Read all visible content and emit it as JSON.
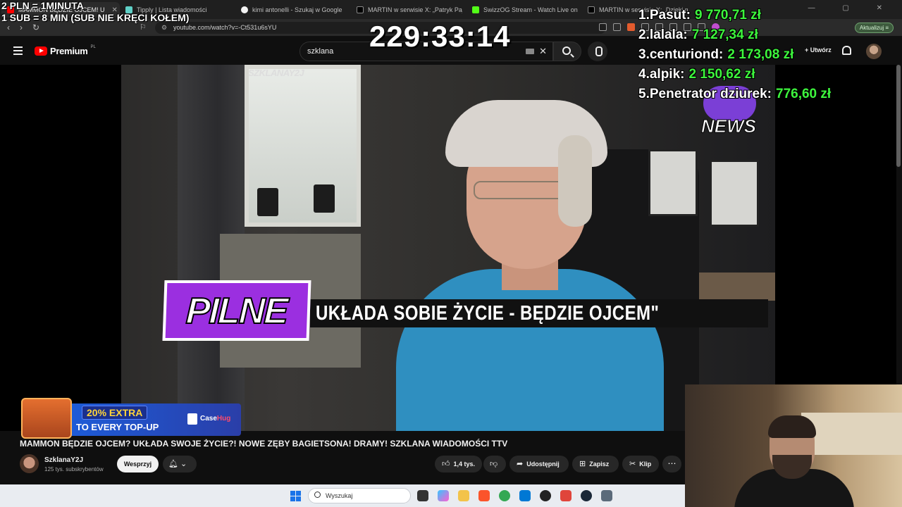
{
  "overlay": {
    "rate_line1": "2 PLN = 1MINUTA",
    "rate_line2": "1 SUB = 8 MIN (SUB NIE KRĘCI KOŁEM)",
    "timer": "229:33:14",
    "leaderboard": [
      {
        "rank": "1.",
        "name": "Pasut:",
        "amount": "9 770,71 zł"
      },
      {
        "rank": "2.",
        "name": "lalala:",
        "amount": "7 127,34 zł"
      },
      {
        "rank": "3.",
        "name": "centuriond:",
        "amount": "2 173,08 zł"
      },
      {
        "rank": "4.",
        "name": "alpik:",
        "amount": "2 150,62 zł"
      },
      {
        "rank": "5.",
        "name": "Penetrator dziurek:",
        "amount": "776,60 zł"
      }
    ],
    "leaderboard_amount_color": "#3df53d"
  },
  "browser": {
    "tabs": [
      {
        "label": "MAMMON BĘDZIE OJCEM! U",
        "active": true,
        "icon": "youtube-icon"
      },
      {
        "label": "Tipply | Lista wiadomości",
        "active": false,
        "icon": "tipply-icon"
      },
      {
        "label": "kimi antonelli - Szukaj w Google",
        "active": false,
        "icon": "google-icon"
      },
      {
        "label": "MARTIN w serwisie X: „Patryk Pajako",
        "active": false,
        "icon": "x-icon"
      },
      {
        "label": "SwizzOG Stream - Watch Live on Kick",
        "active": false,
        "icon": "kick-icon"
      },
      {
        "label": "MARTIN w serwisie X: „Dzieki mory",
        "active": false,
        "icon": "x-icon"
      }
    ],
    "url": "youtube.com/watch?v=-Ct531u6sYU",
    "update_label": "Aktualizuj"
  },
  "youtube": {
    "logo_text": "Premium",
    "logo_region": "PL",
    "search_value": "szklana",
    "create_label": "Utwórz",
    "video": {
      "channel_watermark": "SZKLANAY2J",
      "news_logo": "NEWS",
      "pilne_label": "PILNE",
      "ticker_text": "UKŁADA SOBIE ŻYCIE - BĘDZIE OJCEM\""
    },
    "title": "MAMMON BĘDZIE OJCEM? UKŁADA SWOJE ŻYCIE?! NOWE ZĘBY BAGIETSONA! DRAMY! SZKLANA WIADOMOŚCI TTV",
    "channel_name": "SzklanaY2J",
    "subscribers": "125 tys. subskrybentów",
    "support_label": "Wesprzyj",
    "likes": "1,4 tys.",
    "share_label": "Udostępnij",
    "save_label": "Zapisz",
    "clip_label": "Klip"
  },
  "ad": {
    "percent": "20% EXTRA",
    "line2": "TO EVERY TOP-UP",
    "brand_a": "Case",
    "brand_b": "Hug"
  },
  "taskbar": {
    "search_placeholder": "Wyszukaj"
  }
}
